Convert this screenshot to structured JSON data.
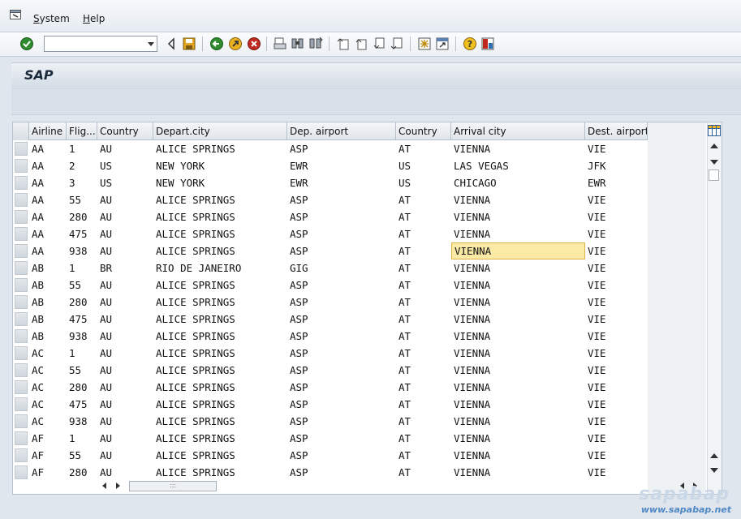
{
  "menu": {
    "items": [
      "System",
      "Help"
    ]
  },
  "toolbar": {
    "command_value": ""
  },
  "title": "SAP",
  "grid": {
    "columns": [
      "Airline",
      "Flig...",
      "Country",
      "Depart.city",
      "Dep. airport",
      "Country",
      "Arrival city",
      "Dest. airport"
    ],
    "rows": [
      [
        "AA",
        "1",
        "AU",
        "ALICE SPRINGS",
        "ASP",
        "AT",
        "VIENNA",
        "VIE"
      ],
      [
        "AA",
        "2",
        "US",
        "NEW YORK",
        "EWR",
        "US",
        "LAS VEGAS",
        "JFK"
      ],
      [
        "AA",
        "3",
        "US",
        "NEW YORK",
        "EWR",
        "US",
        "CHICAGO",
        "EWR"
      ],
      [
        "AA",
        "55",
        "AU",
        "ALICE SPRINGS",
        "ASP",
        "AT",
        "VIENNA",
        "VIE"
      ],
      [
        "AA",
        "280",
        "AU",
        "ALICE SPRINGS",
        "ASP",
        "AT",
        "VIENNA",
        "VIE"
      ],
      [
        "AA",
        "475",
        "AU",
        "ALICE SPRINGS",
        "ASP",
        "AT",
        "VIENNA",
        "VIE"
      ],
      [
        "AA",
        "938",
        "AU",
        "ALICE SPRINGS",
        "ASP",
        "AT",
        "VIENNA",
        "VIE"
      ],
      [
        "AB",
        "1",
        "BR",
        "RIO DE JANEIRO",
        "GIG",
        "AT",
        "VIENNA",
        "VIE"
      ],
      [
        "AB",
        "55",
        "AU",
        "ALICE SPRINGS",
        "ASP",
        "AT",
        "VIENNA",
        "VIE"
      ],
      [
        "AB",
        "280",
        "AU",
        "ALICE SPRINGS",
        "ASP",
        "AT",
        "VIENNA",
        "VIE"
      ],
      [
        "AB",
        "475",
        "AU",
        "ALICE SPRINGS",
        "ASP",
        "AT",
        "VIENNA",
        "VIE"
      ],
      [
        "AB",
        "938",
        "AU",
        "ALICE SPRINGS",
        "ASP",
        "AT",
        "VIENNA",
        "VIE"
      ],
      [
        "AC",
        "1",
        "AU",
        "ALICE SPRINGS",
        "ASP",
        "AT",
        "VIENNA",
        "VIE"
      ],
      [
        "AC",
        "55",
        "AU",
        "ALICE SPRINGS",
        "ASP",
        "AT",
        "VIENNA",
        "VIE"
      ],
      [
        "AC",
        "280",
        "AU",
        "ALICE SPRINGS",
        "ASP",
        "AT",
        "VIENNA",
        "VIE"
      ],
      [
        "AC",
        "475",
        "AU",
        "ALICE SPRINGS",
        "ASP",
        "AT",
        "VIENNA",
        "VIE"
      ],
      [
        "AC",
        "938",
        "AU",
        "ALICE SPRINGS",
        "ASP",
        "AT",
        "VIENNA",
        "VIE"
      ],
      [
        "AF",
        "1",
        "AU",
        "ALICE SPRINGS",
        "ASP",
        "AT",
        "VIENNA",
        "VIE"
      ],
      [
        "AF",
        "55",
        "AU",
        "ALICE SPRINGS",
        "ASP",
        "AT",
        "VIENNA",
        "VIE"
      ],
      [
        "AF",
        "280",
        "AU",
        "ALICE SPRINGS",
        "ASP",
        "AT",
        "VIENNA",
        "VIE"
      ]
    ],
    "selected_row": 6,
    "selected_col": 6
  },
  "hscroll_grip": ":::",
  "watermark": {
    "logo": "sapabap",
    "url": "www.sapabap.net"
  },
  "colors": {
    "highlight": "#fbeaa5",
    "highlight_border": "#e0b44a",
    "accent_green": "#2e8b2e",
    "accent_red": "#c0281e"
  }
}
